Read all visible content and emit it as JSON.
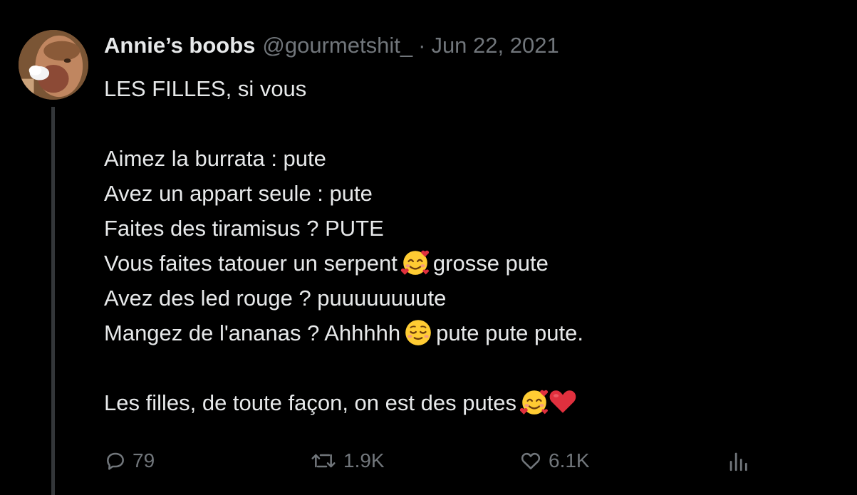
{
  "tweet": {
    "display_name": "Annie’s boobs",
    "handle": "@gourmetshit_",
    "separator": "·",
    "date": "Jun 22, 2021",
    "lines": {
      "l1": "LES FILLES, si vous",
      "l2": "Aimez la burrata : pute",
      "l3": "Avez un appart seule : pute",
      "l4": "Faites des tiramisus ? PUTE",
      "l5a": "Vous faites tatouer un serpent",
      "l5b": "grosse pute",
      "l6": "Avez des led rouge ? puuuuuuuute",
      "l7a": "Mangez de l'ananas ? Ahhhhh",
      "l7b": "pute pute pute.",
      "l8": "Les filles, de toute façon, on est des putes"
    },
    "emoji": {
      "smiling_hearts": "smiling-face-with-hearts",
      "relieved": "relieved-face",
      "heart": "red-heart"
    }
  },
  "actions": {
    "reply_count": "79",
    "retweet_count": "1.9K",
    "like_count": "6.1K",
    "icons": {
      "reply": "reply-icon",
      "retweet": "retweet-icon",
      "like": "like-icon",
      "views": "views-icon"
    }
  },
  "colors": {
    "background": "#000000",
    "text": "#e7e9ea",
    "muted": "#71767b",
    "thread_line": "#333639",
    "heart_red": "#e0303e",
    "emoji_yellow": "#ffcc33"
  }
}
